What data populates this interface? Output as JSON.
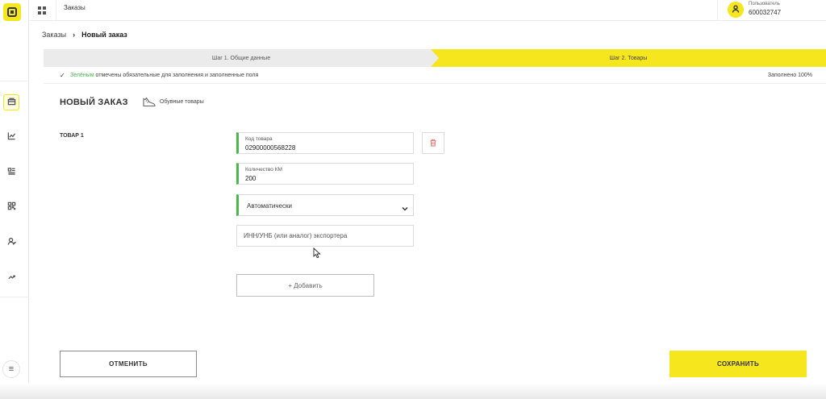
{
  "sidebar": {
    "logo_icon": "app-logo-icon",
    "items": [
      {
        "icon": "orders-icon",
        "active": true
      },
      {
        "icon": "chart-icon",
        "active": false
      },
      {
        "icon": "list-icon",
        "active": false
      },
      {
        "icon": "qr-icon",
        "active": false
      },
      {
        "icon": "users-icon",
        "active": false
      },
      {
        "icon": "exchange-icon",
        "active": false
      }
    ],
    "menu_glyph": "≡"
  },
  "topbar": {
    "title": "Заказы",
    "user_label": "Пользователь",
    "user_id": "600032747"
  },
  "breadcrumb": {
    "parent": "Заказы",
    "separator": "›",
    "current": "Новый заказ"
  },
  "stepper": {
    "step1": "Шаг 1. Общие данные",
    "step2": "Шаг 2. Товары"
  },
  "notice": {
    "check": "✓",
    "green_word": "Зелёным",
    "text": " отмечены обязательные для заполнения и заполненные поля",
    "progress": "Заполнено 100%"
  },
  "form": {
    "title": "НОВЫЙ ЗАКАЗ",
    "category": "Обувные товары",
    "item_label": "ТОВАР 1",
    "product_code_label": "Код товара",
    "product_code_value": "02900000568228",
    "quantity_label": "Количество КМ",
    "quantity_value": "200",
    "mode_selected": "Автоматически",
    "exporter_placeholder": "ИНН/УНБ (или аналог) экспортера",
    "add_label": "+ Добавить"
  },
  "actions": {
    "cancel": "ОТМЕНИТЬ",
    "save": "СОХРАНИТЬ"
  },
  "colors": {
    "accent": "#f5e61e",
    "valid_green": "#47b84c"
  }
}
